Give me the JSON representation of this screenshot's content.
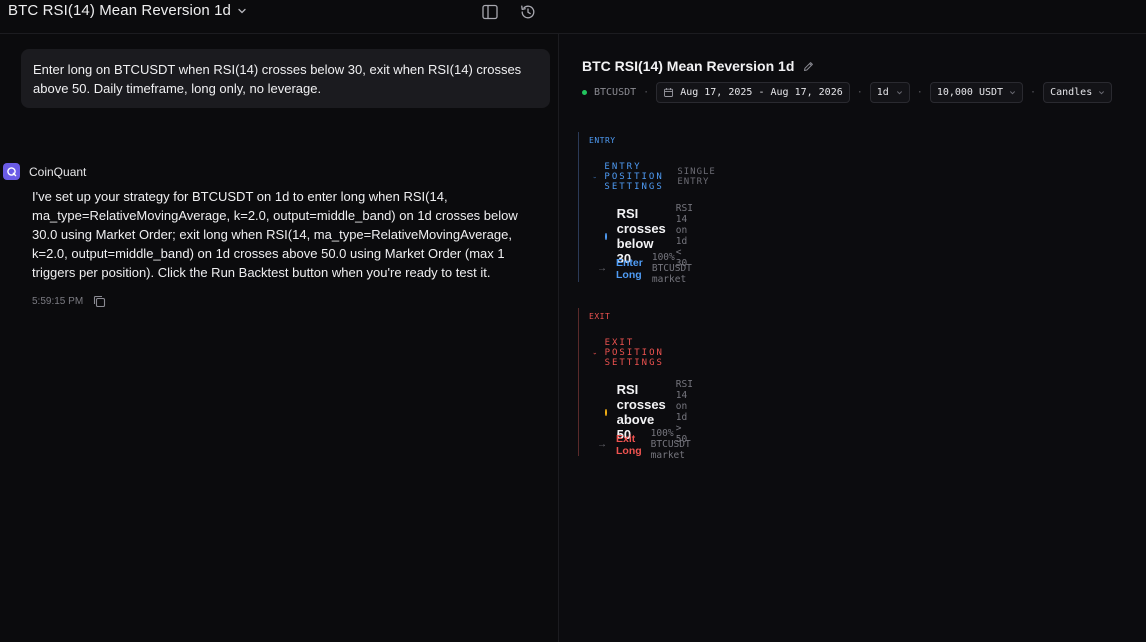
{
  "header": {
    "title": "BTC RSI(14) Mean Reversion 1d"
  },
  "chat": {
    "user_message": "Enter long on BTCUSDT when RSI(14) crosses below 30, exit when RSI(14) crosses above 50. Daily timeframe, long only, no leverage.",
    "assistant_name": "CoinQuant",
    "assistant_message": "I've set up your strategy for BTCUSDT on 1d to enter long when RSI(14, ma_type=RelativeMovingAverage, k=2.0, output=middle_band) on 1d crosses below 30.0 using Market Order; exit long when RSI(14, ma_type=RelativeMovingAverage, k=2.0, output=middle_band) on 1d crosses above 50.0 using Market Order (max 1 triggers per position). Click the Run Backtest button when you're ready to test it.",
    "timestamp": "5:59:15 PM"
  },
  "strategy": {
    "title": "BTC RSI(14) Mean Reversion 1d",
    "symbol": "BTCUSDT",
    "date_range": "Aug 17, 2025 - Aug 17, 2026",
    "timeframe": "1d",
    "capital": "10,000 USDT",
    "view": "Candles",
    "entry": {
      "tag": "ENTRY",
      "header": "ENTRY POSITION SETTINGS",
      "sub": "SINGLE ENTRY",
      "condition_label": "RSI crosses below 30",
      "condition_detail": "RSI 14 on 1d < 30",
      "action_label": "Enter Long",
      "action_detail": "100% BTCUSDT market"
    },
    "exit": {
      "tag": "EXIT",
      "header": "EXIT POSITION SETTINGS",
      "condition_label": "RSI crosses above 50",
      "condition_detail": "RSI 14 on 1d > 50",
      "action_label": "Exit Long",
      "action_detail": "100% BTCUSDT market"
    }
  },
  "colors": {
    "entry_accent": "#4f9cf5",
    "exit_accent": "#ef5350",
    "entry_dot": "#4f9cf5",
    "exit_dot": "#f5b014",
    "status_dot": "#22c55e",
    "avatar": "#6a5be6"
  },
  "icons": [
    "chevron-down-icon",
    "sidebar-toggle-icon",
    "history-icon",
    "coinquant-logo-icon",
    "copy-icon",
    "pencil-icon",
    "chevron-right-icon",
    "arrow-right-icon"
  ]
}
